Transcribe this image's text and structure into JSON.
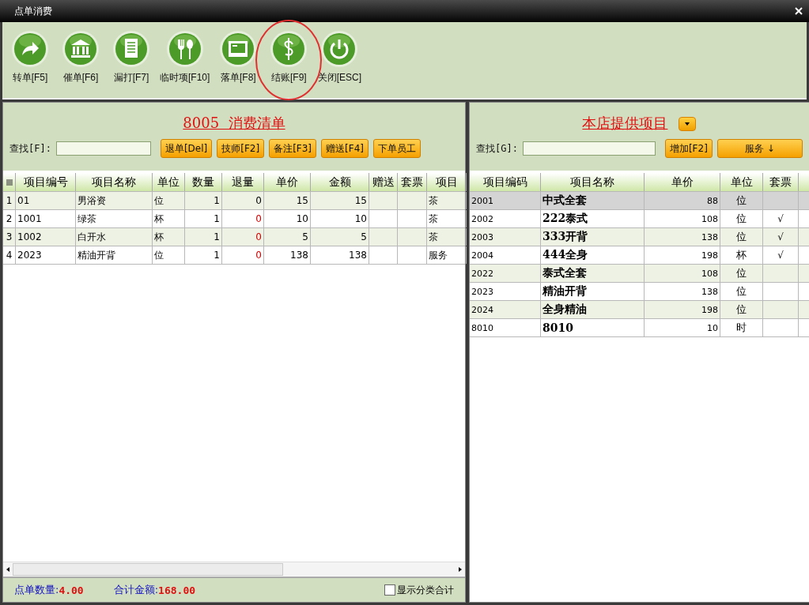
{
  "window": {
    "title": "点单消费"
  },
  "toolbar": [
    {
      "label": "转单[F5]",
      "highlighted": false
    },
    {
      "label": "催单[F6]",
      "highlighted": false
    },
    {
      "label": "漏打[F7]",
      "highlighted": false
    },
    {
      "label": "临时项[F10]",
      "highlighted": false
    },
    {
      "label": "落单[F8]",
      "highlighted": false
    },
    {
      "label": "结账[F9]",
      "highlighted": true
    },
    {
      "label": "关闭[ESC]",
      "highlighted": false
    }
  ],
  "order_panel": {
    "title": "8005  消费清单",
    "search_label": "查找[F]:",
    "buttons": [
      "退单[Del]",
      "技师[F2]",
      "备注[F3]",
      "赠送[F4]",
      "下单员工"
    ],
    "columns": [
      "项目编号",
      "项目名称",
      "单位",
      "数量",
      "退量",
      "单价",
      "金额",
      "赠送",
      "套票",
      "项目"
    ],
    "rows": [
      {
        "index": "1",
        "cells": [
          "01",
          "男浴资",
          "位",
          "1",
          "0",
          "15",
          "15",
          "",
          "",
          "茶"
        ],
        "return_marked": false
      },
      {
        "index": "2",
        "cells": [
          "1001",
          "绿茶",
          "杯",
          "1",
          "0",
          "10",
          "10",
          "",
          "",
          "茶"
        ],
        "return_marked": true
      },
      {
        "index": "3",
        "cells": [
          "1002",
          "白开水",
          "杯",
          "1",
          "0",
          "5",
          "5",
          "",
          "",
          "茶"
        ],
        "return_marked": true
      },
      {
        "index": "4",
        "cells": [
          "2023",
          "精油开背",
          "位",
          "1",
          "0",
          "138",
          "138",
          "",
          "",
          "服务"
        ],
        "return_marked": true
      }
    ],
    "footer": {
      "count_label": "点单数量:",
      "count": "4.00",
      "total_label": "合计金额:",
      "total": "168.00",
      "checkbox_label": "显示分类合计",
      "checked": false
    }
  },
  "items_panel": {
    "title": "本店提供项目",
    "search_label": "查找[G]:",
    "add_button": "增加[F2]",
    "category_button": "服务 ↓",
    "columns": [
      "项目编码",
      "项目名称",
      "单价",
      "单位",
      "套票"
    ],
    "rows": [
      {
        "code": "2001",
        "name": "中式全套",
        "price": "88",
        "unit": "位",
        "package": false,
        "selected": true
      },
      {
        "code": "2002",
        "name": "222泰式",
        "price": "108",
        "unit": "位",
        "package": true,
        "selected": false
      },
      {
        "code": "2003",
        "name": "333开背",
        "price": "138",
        "unit": "位",
        "package": true,
        "selected": false
      },
      {
        "code": "2004",
        "name": "444全身",
        "price": "198",
        "unit": "杯",
        "package": true,
        "selected": false
      },
      {
        "code": "2022",
        "name": "泰式全套",
        "price": "108",
        "unit": "位",
        "package": false,
        "selected": false
      },
      {
        "code": "2023",
        "name": "精油开背",
        "price": "138",
        "unit": "位",
        "package": false,
        "selected": false
      },
      {
        "code": "2024",
        "name": "全身精油",
        "price": "198",
        "unit": "位",
        "package": false,
        "selected": false
      },
      {
        "code": "8010",
        "name": "8010",
        "price": "10",
        "unit": "时",
        "package": false,
        "selected": false
      }
    ],
    "check_mark": "√"
  }
}
